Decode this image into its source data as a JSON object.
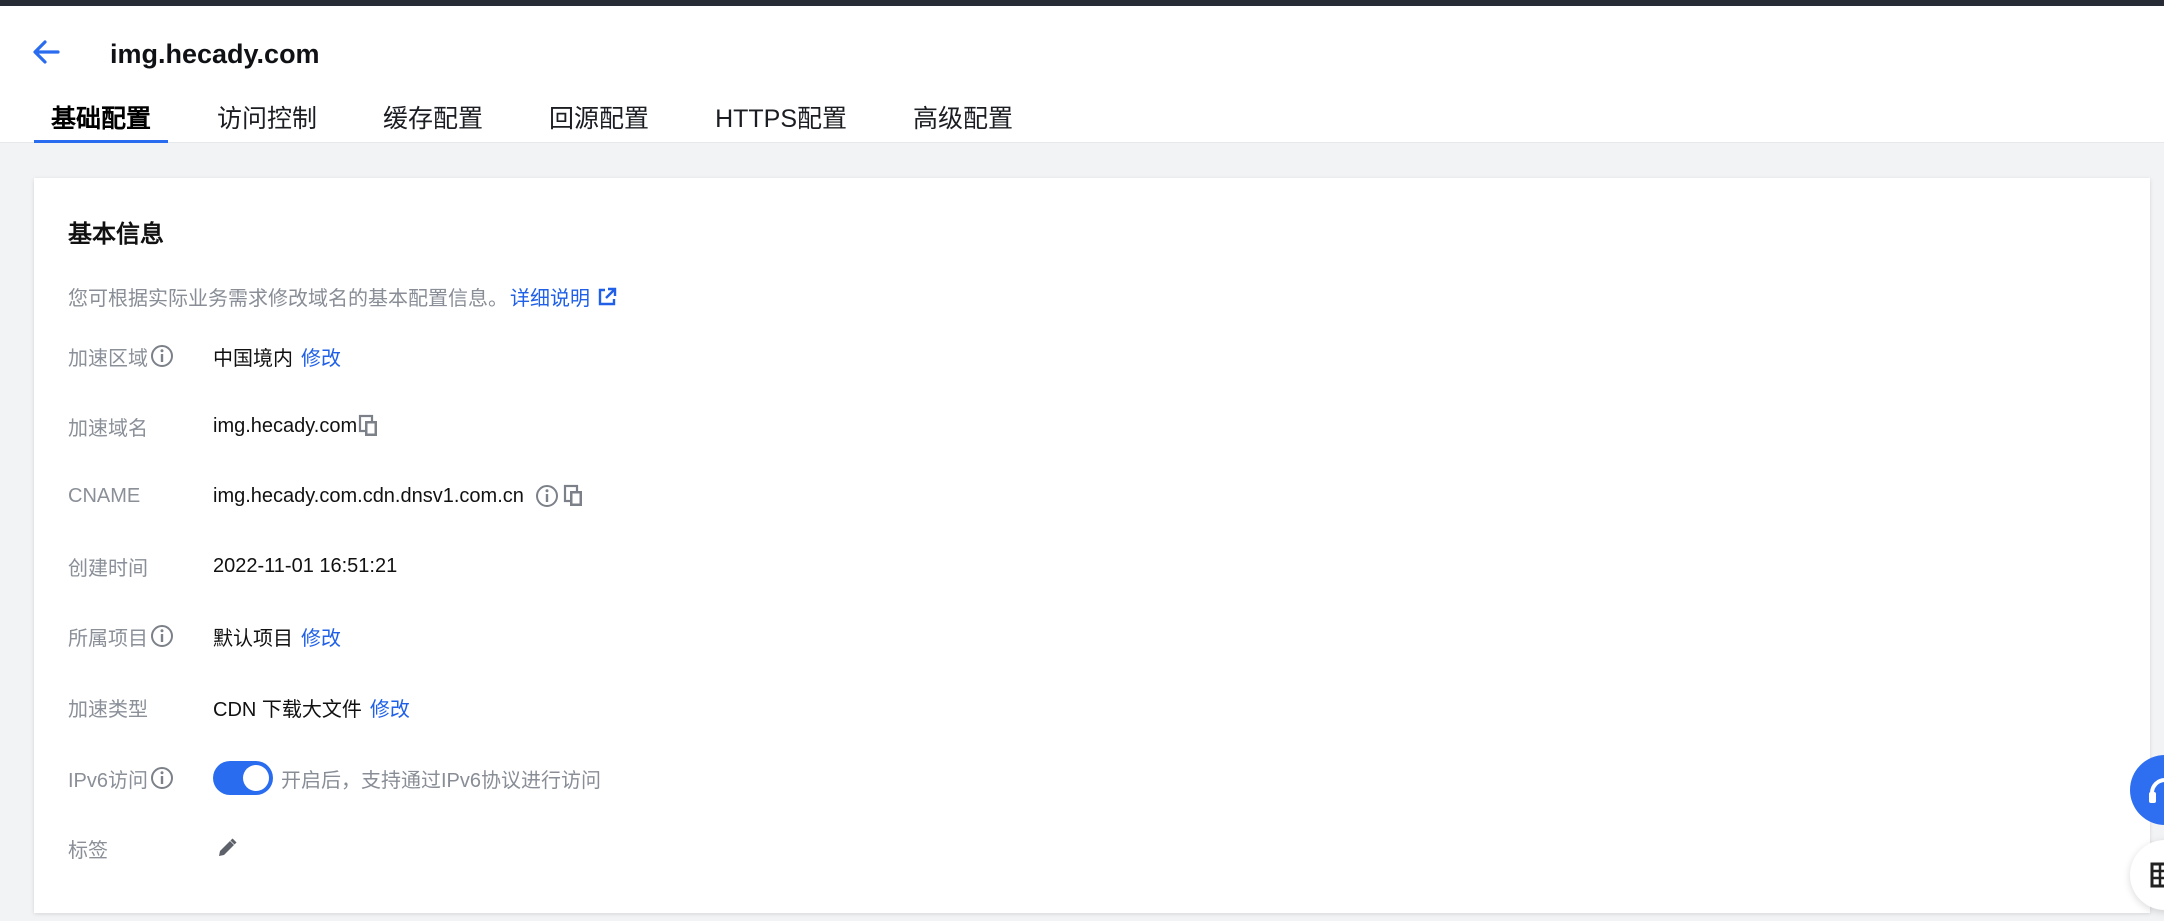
{
  "header": {
    "title": "img.hecady.com",
    "back_icon": "arrow-left-icon"
  },
  "tabs": [
    {
      "label": "基础配置",
      "active": true
    },
    {
      "label": "访问控制",
      "active": false
    },
    {
      "label": "缓存配置",
      "active": false
    },
    {
      "label": "回源配置",
      "active": false
    },
    {
      "label": "HTTPS配置",
      "active": false
    },
    {
      "label": "高级配置",
      "active": false
    }
  ],
  "card": {
    "title": "基本信息",
    "description": "您可根据实际业务需求修改域名的基本配置信息。",
    "detail_link": "详细说明",
    "rows": {
      "region": {
        "label": "加速区域",
        "value": "中国境内",
        "action": "修改"
      },
      "domain": {
        "label": "加速域名",
        "value": "img.hecady.com"
      },
      "cname": {
        "label": "CNAME",
        "value": "img.hecady.com.cdn.dnsv1.com.cn"
      },
      "created": {
        "label": "创建时间",
        "value": "2022-11-01 16:51:21"
      },
      "project": {
        "label": "所属项目",
        "value": "默认项目",
        "action": "修改"
      },
      "type": {
        "label": "加速类型",
        "value": "CDN 下载大文件",
        "action": "修改"
      },
      "ipv6": {
        "label": "IPv6访问",
        "enabled": true,
        "hint": "开启后，支持通过IPv6协议进行访问"
      },
      "tags": {
        "label": "标签"
      }
    }
  },
  "colors": {
    "accent": "#2a6cf0",
    "link": "#2060e8",
    "topbar": "#262b36"
  }
}
